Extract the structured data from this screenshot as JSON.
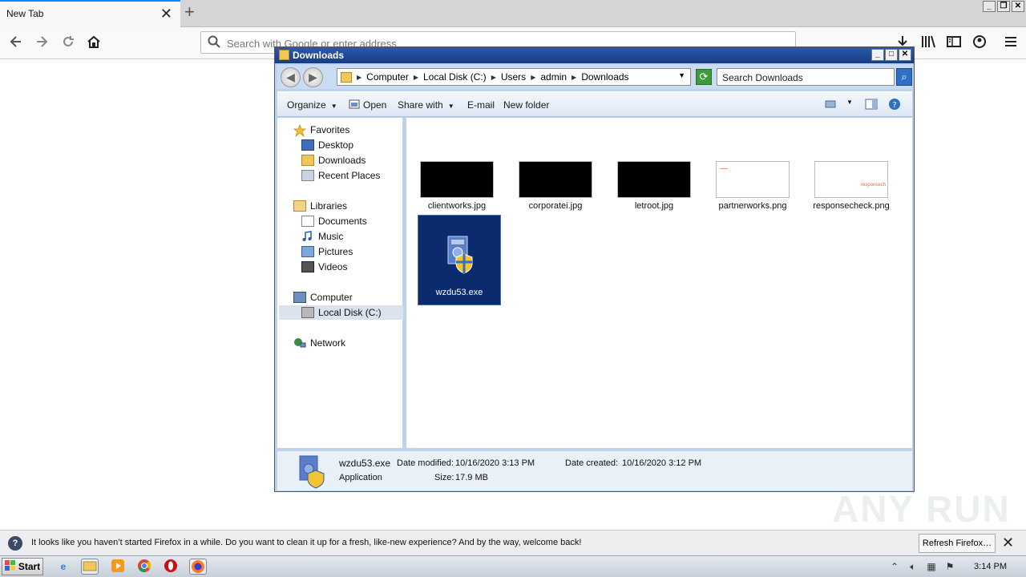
{
  "firefox": {
    "tab_title": "New Tab",
    "tab_close": "✕",
    "new_tab": "+",
    "url_placeholder": "Search with Google or enter address",
    "win_controls": [
      "_",
      "❐",
      "✕"
    ]
  },
  "explorer": {
    "title": "Downloads",
    "win_controls": [
      "_",
      "□",
      "✕"
    ],
    "breadcrumb": [
      "Computer",
      "Local Disk (C:)",
      "Users",
      "admin",
      "Downloads"
    ],
    "search_placeholder": "Search Downloads",
    "commands": {
      "organize": "Organize",
      "open": "Open",
      "share_with": "Share with",
      "email": "E-mail",
      "new_folder": "New folder"
    },
    "nav": {
      "favorites": "Favorites",
      "desktop": "Desktop",
      "downloads": "Downloads",
      "recent_places": "Recent Places",
      "libraries": "Libraries",
      "documents": "Documents",
      "music": "Music",
      "pictures": "Pictures",
      "videos": "Videos",
      "computer": "Computer",
      "local_disk": "Local Disk (C:)",
      "network": "Network"
    },
    "files": [
      {
        "name": "clientworks.jpg"
      },
      {
        "name": "corporatei.jpg"
      },
      {
        "name": "letroot.jpg"
      },
      {
        "name": "partnerworks.png"
      },
      {
        "name": "responsecheck.png",
        "thumb_text": "responsech"
      },
      {
        "name": "wzdu53.exe"
      }
    ],
    "details": {
      "filename": "wzdu53.exe",
      "type": "Application",
      "modified_label": "Date modified:",
      "modified_value": "10/16/2020 3:13 PM",
      "created_label": "Date created:",
      "created_value": "10/16/2020 3:12 PM",
      "size_label": "Size:",
      "size_value": "17.9 MB"
    }
  },
  "notification": {
    "message": "It looks like you haven’t started Firefox in a while. Do you want to clean it up for a fresh, like-new experience? And by the way, welcome back!",
    "refresh_button": "Refresh Firefox…",
    "close": "✕"
  },
  "taskbar": {
    "start": "Start",
    "clock": "3:14 PM"
  },
  "watermark": "ANY RUN"
}
